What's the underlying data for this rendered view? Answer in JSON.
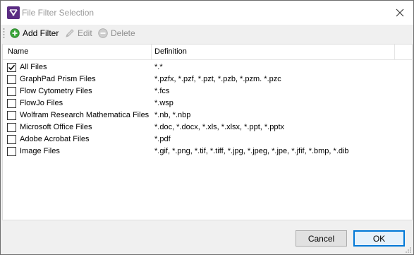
{
  "window": {
    "title": "File Filter Selection"
  },
  "toolbar": {
    "add_label": "Add Filter",
    "edit_label": "Edit",
    "delete_label": "Delete"
  },
  "columns": {
    "name": "Name",
    "definition": "Definition"
  },
  "rows": [
    {
      "name": "All Files",
      "definition": "*.*",
      "checked": true
    },
    {
      "name": "GraphPad Prism Files",
      "definition": "*.pzfx, *.pzf, *.pzt, *.pzb, *.pzm. *.pzc",
      "checked": false
    },
    {
      "name": "Flow Cytometry Files",
      "definition": "*.fcs",
      "checked": false
    },
    {
      "name": "FlowJo Files",
      "definition": "*.wsp",
      "checked": false
    },
    {
      "name": "Wolfram Research Mathematica Files",
      "definition": "*.nb, *.nbp",
      "checked": false
    },
    {
      "name": "Microsoft Office Files",
      "definition": "*.doc, *.docx, *.xls, *.xlsx, *.ppt, *.pptx",
      "checked": false
    },
    {
      "name": "Adobe Acrobat Files",
      "definition": "*.pdf",
      "checked": false
    },
    {
      "name": "Image Files",
      "definition": "*.gif, *.png, *.tif, *.tiff, *.jpg, *.jpeg, *.jpe, *.jfif, *.bmp, *.dib",
      "checked": false
    }
  ],
  "footer": {
    "cancel_label": "Cancel",
    "ok_label": "OK"
  },
  "colors": {
    "accent": "#0078d7",
    "add_icon": "#3aa63a",
    "disabled_text": "#8f8f8f"
  },
  "icons": [
    "app-icon",
    "close-icon",
    "add-icon",
    "edit-icon",
    "delete-icon",
    "checkmark-icon"
  ]
}
